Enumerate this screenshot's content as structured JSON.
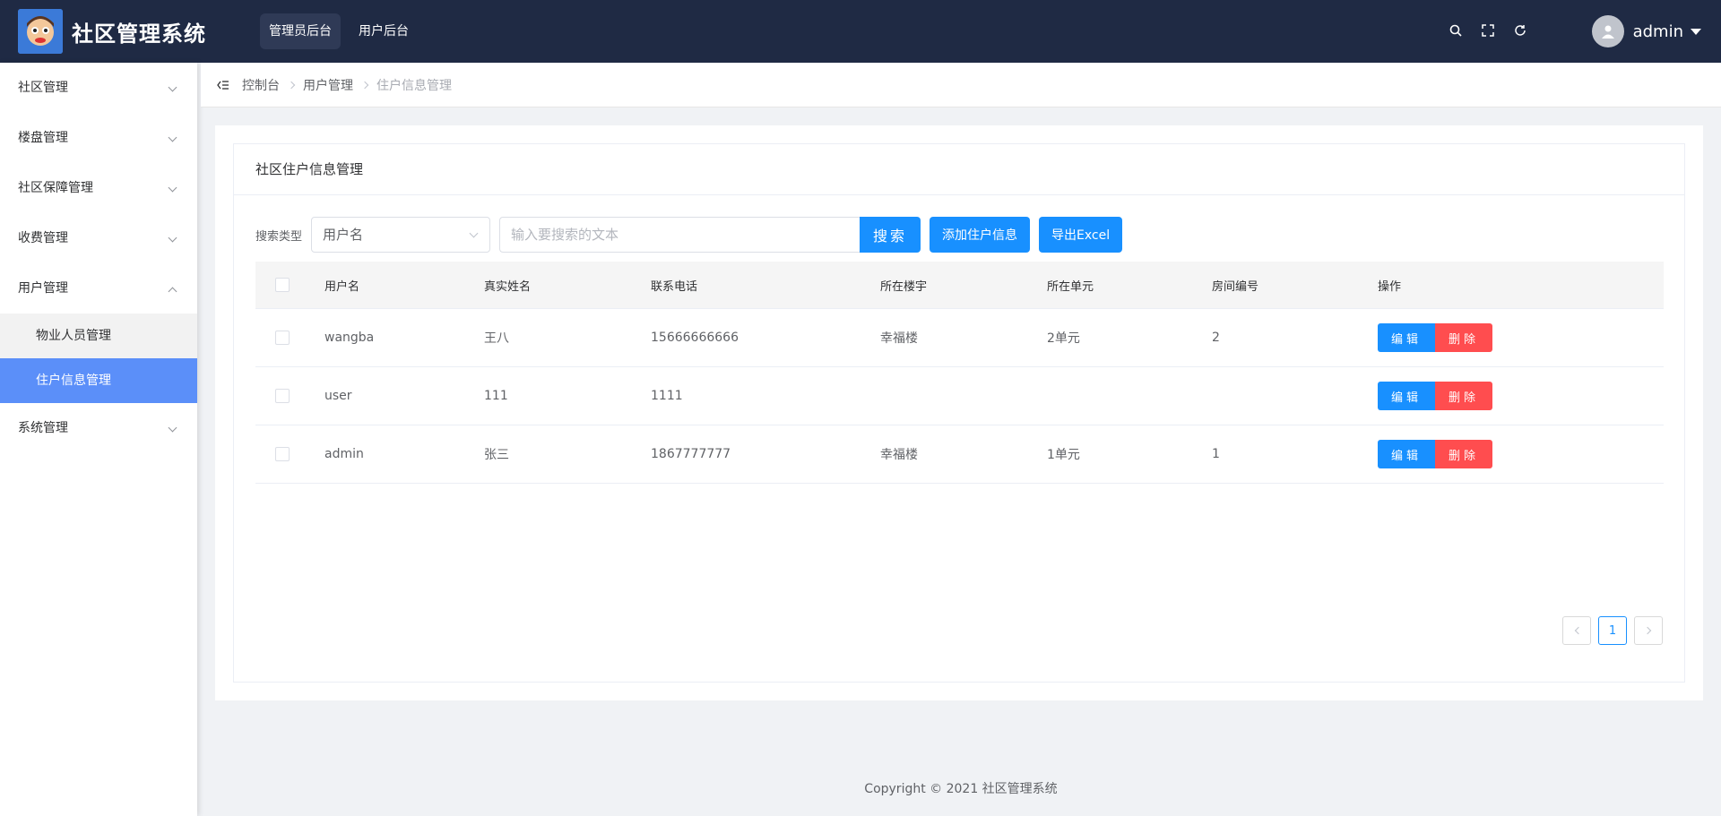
{
  "header": {
    "app_title": "社区管理系统",
    "nav": [
      {
        "label": "管理员后台",
        "active": true
      },
      {
        "label": "用户后台",
        "active": false
      }
    ],
    "tool_icons": [
      "search-icon",
      "fullscreen-icon",
      "refresh-icon"
    ],
    "username": "admin"
  },
  "sidebar": {
    "items": [
      {
        "label": "社区管理",
        "expanded": false
      },
      {
        "label": "楼盘管理",
        "expanded": false
      },
      {
        "label": "社区保障管理",
        "expanded": false
      },
      {
        "label": "收费管理",
        "expanded": false
      },
      {
        "label": "用户管理",
        "expanded": true,
        "children": [
          {
            "label": "物业人员管理",
            "active": false
          },
          {
            "label": "住户信息管理",
            "active": true
          }
        ]
      },
      {
        "label": "系统管理",
        "expanded": false
      }
    ]
  },
  "breadcrumb": [
    "控制台",
    "用户管理",
    "住户信息管理"
  ],
  "card": {
    "title": "社区住户信息管理"
  },
  "toolbar": {
    "search_type_label": "搜索类型",
    "search_type_value": "用户名",
    "search_placeholder": "输入要搜索的文本",
    "search_button": "搜索",
    "add_button": "添加住户信息",
    "export_button": "导出Excel"
  },
  "table": {
    "columns": [
      "用户名",
      "真实姓名",
      "联系电话",
      "所在楼宇",
      "所在单元",
      "房间编号",
      "操作"
    ],
    "rows": [
      {
        "username": "wangba",
        "real_name": "王八",
        "phone": "15666666666",
        "building": "幸福楼",
        "unit": "2单元",
        "room": "2"
      },
      {
        "username": "user",
        "real_name": "111",
        "phone": "1111",
        "building": "",
        "unit": "",
        "room": ""
      },
      {
        "username": "admin",
        "real_name": "张三",
        "phone": "1867777777",
        "building": "幸福楼",
        "unit": "1单元",
        "room": "1"
      }
    ],
    "edit_label": "编辑",
    "delete_label": "删除"
  },
  "pagination": {
    "current_page": "1"
  },
  "footer": {
    "copyright": "Copyright © 2021 社区管理系统"
  },
  "colors": {
    "header_bg": "#1f2a44",
    "primary": "#1890ff",
    "danger": "#ff4d4f",
    "menu_active": "#5b8ff9"
  }
}
